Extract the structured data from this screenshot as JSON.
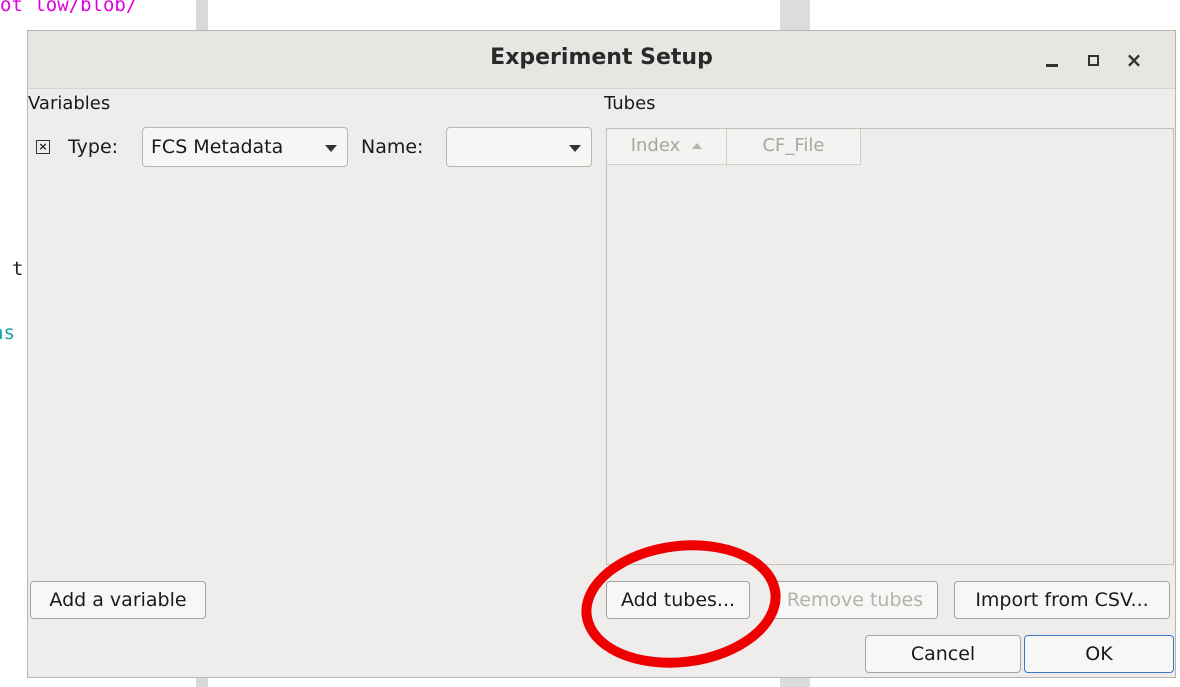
{
  "background": {
    "fragment_top": "ot low/blob/",
    "fragment_t": "t",
    "fragment_as": "as"
  },
  "dialog": {
    "title": "Experiment Setup",
    "variables_label": "Variables",
    "tubes_label": "Tubes",
    "type_label": "Type:",
    "type_value": "FCS Metadata",
    "name_label": "Name:",
    "name_value": "",
    "delete_icon": "×",
    "table_columns": [
      "Index",
      "CF_File"
    ],
    "buttons": {
      "add_variable": "Add a variable",
      "add_tubes": "Add tubes...",
      "remove_tubes": "Remove tubes",
      "import_csv": "Import from CSV...",
      "cancel": "Cancel",
      "ok": "OK"
    },
    "window_controls": {
      "close": "×"
    }
  },
  "colors": {
    "annotation": "#ee0000",
    "default_button_border": "#3c78c8"
  }
}
